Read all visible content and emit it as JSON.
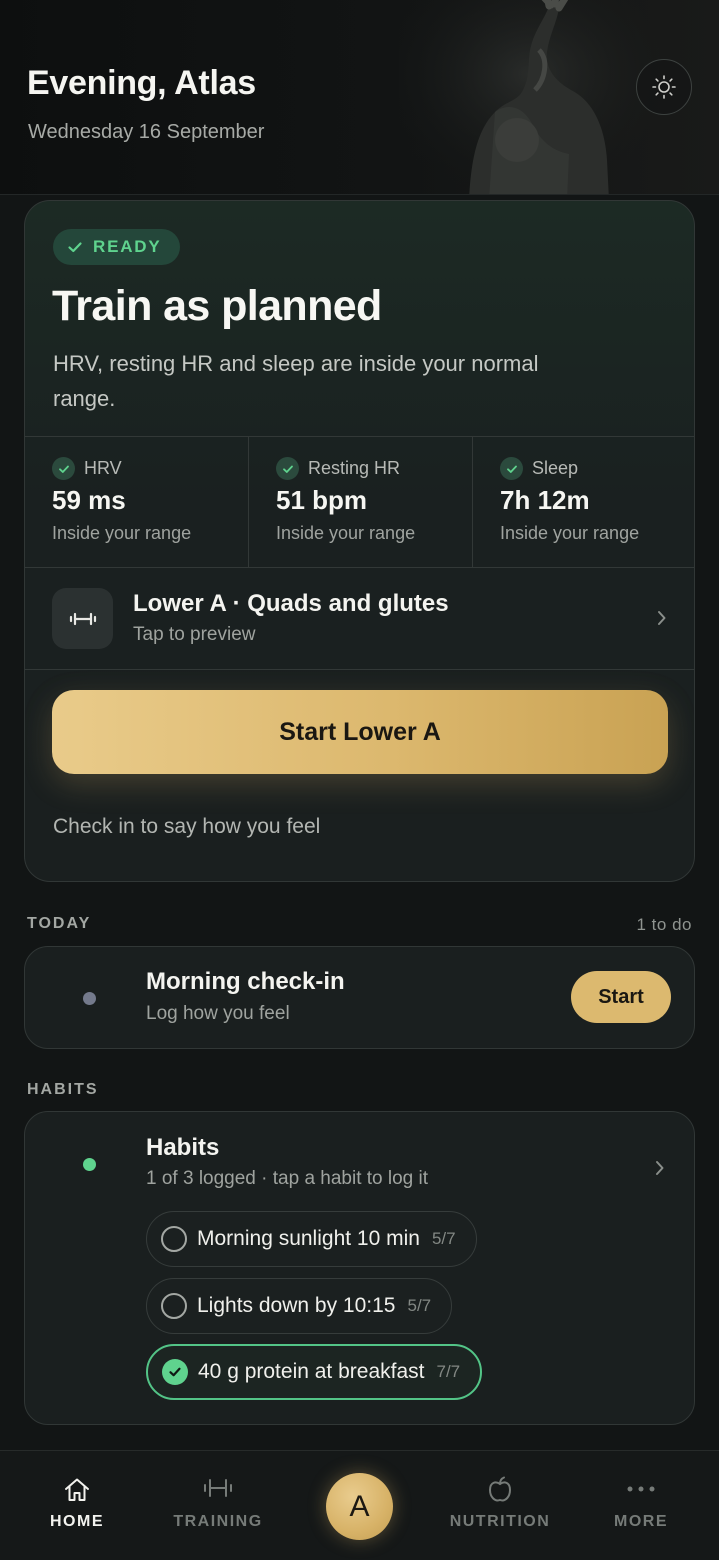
{
  "header": {
    "greeting": "Evening, Atlas",
    "date": "Wednesday 16 September",
    "theme_icon": "sun-icon"
  },
  "readiness": {
    "badge": "READY",
    "title": "Train as planned",
    "description": "HRV, resting HR and sleep are inside your normal range.",
    "metrics": [
      {
        "label": "HRV",
        "value": "59 ms",
        "status": "Inside your range"
      },
      {
        "label": "Resting HR",
        "value": "51 bpm",
        "status": "Inside your range"
      },
      {
        "label": "Sleep",
        "value": "7h 12m",
        "status": "Inside your range"
      }
    ],
    "workout": {
      "title": "Lower A · Quads and glutes",
      "subtitle": "Tap to preview",
      "icon": "dumbbell-icon"
    },
    "start_label": "Start Lower A",
    "checkin_text": "Check in to say how you feel"
  },
  "today": {
    "section_label": "TODAY",
    "count": "1 to do",
    "item": {
      "title": "Morning check-in",
      "subtitle": "Log how you feel",
      "action": "Start"
    }
  },
  "habits": {
    "section_label": "HABITS",
    "title": "Habits",
    "subtitle": "1 of 3 logged · tap a habit to log it",
    "items": [
      {
        "name": "Morning sunlight 10 min",
        "count": "5/7",
        "done": false
      },
      {
        "name": "Lights down by 10:15",
        "count": "5/7",
        "done": false
      },
      {
        "name": "40 g protein at breakfast",
        "count": "7/7",
        "done": true
      }
    ]
  },
  "nav": {
    "items": [
      {
        "label": "HOME",
        "icon": "home-icon",
        "active": true
      },
      {
        "label": "TRAINING",
        "icon": "dumbbell-icon",
        "active": false
      },
      {
        "label": "A",
        "icon": "avatar",
        "active": false
      },
      {
        "label": "NUTRITION",
        "icon": "apple-icon",
        "active": false
      },
      {
        "label": "MORE",
        "icon": "more-icon",
        "active": false
      }
    ]
  },
  "colors": {
    "accent_gold": "#dcb96f",
    "ready_green": "#5fd38e",
    "background": "#121515",
    "card": "#1a1f1f"
  }
}
